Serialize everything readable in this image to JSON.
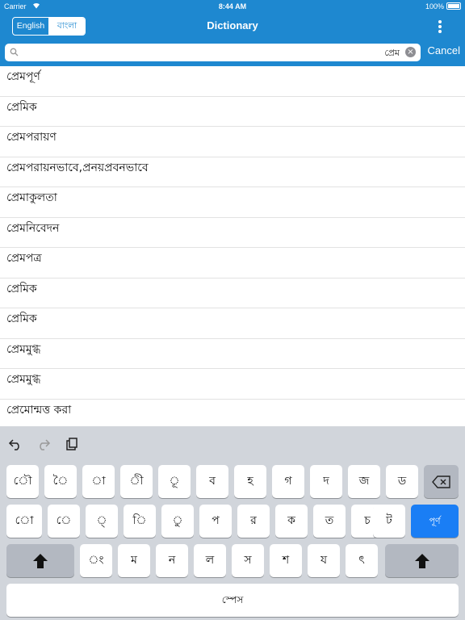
{
  "status": {
    "carrier": "Carrier",
    "time": "8:44 AM",
    "battery": "100%"
  },
  "nav": {
    "segments": [
      "English",
      "বাংলা"
    ],
    "selected_segment": "বাংলা",
    "title": "Dictionary"
  },
  "search": {
    "value": "প্রেম",
    "clear": "×",
    "cancel": "Cancel"
  },
  "results": [
    "প্রেমপূর্ণ",
    "প্রেমিক",
    "প্রেমপরায়ণ",
    "প্রেমপরায়নভাবে,প্রনয়প্রবনভাবে",
    "প্রেমাকুলতা",
    "প্রেমনিবেদন",
    "প্রেমপত্র",
    "প্রেমিক",
    "প্রেমিক",
    "প্রেমমুগ্ধ",
    "প্রেমমুগ্ধ",
    "প্রেমোন্মত্ত করা"
  ],
  "keyboard": {
    "row1": [
      "ৌ",
      "ৈ",
      "া",
      "ী",
      "ূ",
      "ব",
      "হ",
      "গ",
      "দ",
      "জ",
      "ড"
    ],
    "row2": [
      "ো",
      "ে",
      "্",
      "ি",
      "ু",
      "প",
      "র",
      "ক",
      "ত",
      "চ",
      "ট"
    ],
    "row3": [
      "ং",
      "ম",
      "ন",
      "ল",
      "স",
      "শ",
      "য",
      "ৎ"
    ],
    "go_label": "পূর্ণ",
    "space_label": "স্পেস"
  },
  "colors": {
    "accent": "#1e88d0",
    "go": "#1a7ef5",
    "keyboard_bg": "#d1d5db"
  }
}
